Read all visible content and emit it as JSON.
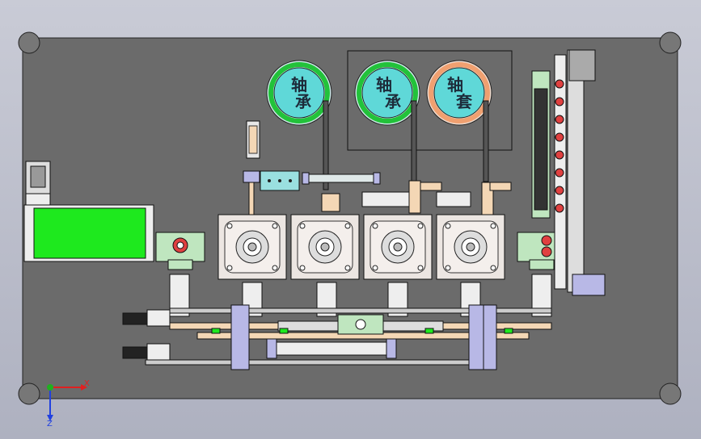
{
  "dials": [
    {
      "label_top": "轴",
      "label_bottom": "承",
      "ring_color": "#22c23a"
    },
    {
      "label_top": "轴",
      "label_bottom": "承",
      "ring_color": "#22c23a"
    },
    {
      "label_top": "轴",
      "label_bottom": "套",
      "ring_color": "#f0a070"
    }
  ],
  "axis": {
    "x_label": "X",
    "z_label": "Z"
  },
  "colors": {
    "plate": "#6b6b6b",
    "green_block": "#1ee91e",
    "dial_face": "#5fd8d8",
    "motor_body": "#ece6e2",
    "lavender": "#b8b8e6",
    "slide_block": "#f4d7b5"
  },
  "counts": {
    "motors": 4,
    "dials": 3,
    "rail_units": 8
  }
}
